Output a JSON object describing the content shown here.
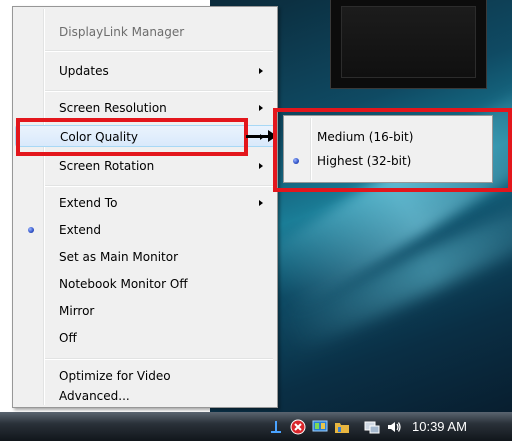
{
  "menu": {
    "title": "DisplayLink Manager",
    "items": [
      {
        "label": "Updates",
        "submenu": true
      },
      {
        "label": "Screen Resolution",
        "submenu": true
      },
      {
        "label": "Color Quality",
        "submenu": true
      },
      {
        "label": "Screen Rotation",
        "submenu": true
      },
      {
        "label": "Extend To",
        "submenu": true
      },
      {
        "label": "Extend",
        "checked": true
      },
      {
        "label": "Set as Main Monitor"
      },
      {
        "label": "Notebook Monitor Off"
      },
      {
        "label": "Mirror"
      },
      {
        "label": "Off"
      },
      {
        "label": "Optimize for Video"
      },
      {
        "label": "Advanced..."
      }
    ]
  },
  "submenu": {
    "items": [
      {
        "label": "Medium (16-bit)"
      },
      {
        "label": "Highest (32-bit)",
        "checked": true
      }
    ]
  },
  "taskbar": {
    "clock": "10:39 AM"
  },
  "colors": {
    "highlight_box": "#e3161c",
    "menu_background": "#f0f0f0",
    "radio_bullet": "#2f52c8"
  },
  "icons": [
    "network-icon",
    "error-shield-icon",
    "displaylink-icon",
    "folder-icon",
    "display-icon",
    "volume-icon"
  ]
}
